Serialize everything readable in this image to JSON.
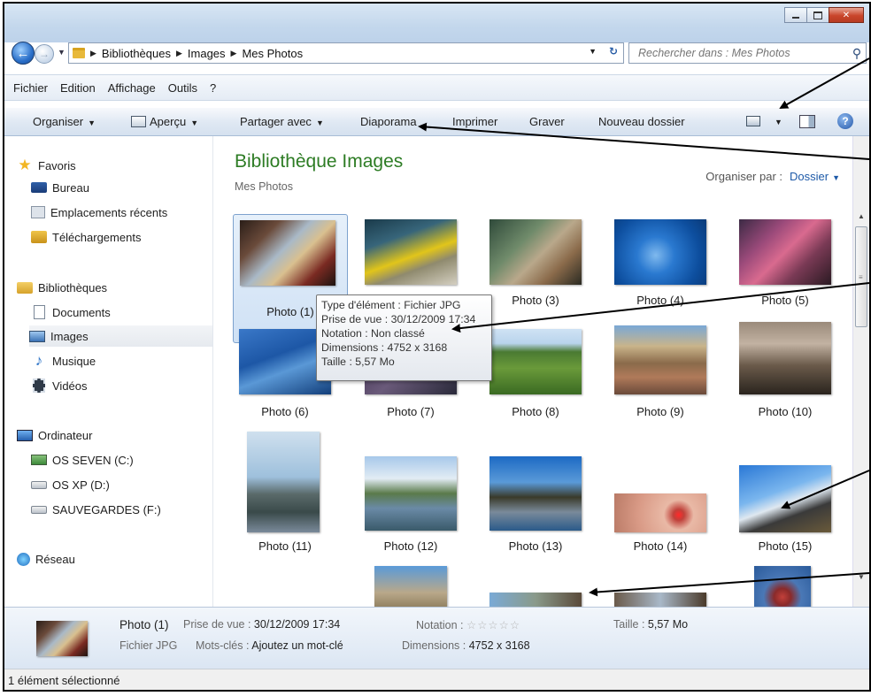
{
  "address": {
    "crumbs": [
      "Bibliothèques",
      "Images",
      "Mes Photos"
    ]
  },
  "search": {
    "placeholder": "Rechercher dans : Mes Photos"
  },
  "menu": [
    "Fichier",
    "Edition",
    "Affichage",
    "Outils",
    "?"
  ],
  "commands": {
    "organiser": "Organiser",
    "apercu": "Aperçu",
    "partager": "Partager avec",
    "diaporama": "Diaporama",
    "imprimer": "Imprimer",
    "graver": "Graver",
    "nouveau_dossier": "Nouveau dossier"
  },
  "sidebar": {
    "favoris": "Favoris",
    "bureau": "Bureau",
    "recents": "Emplacements récents",
    "telechargements": "Téléchargements",
    "bibliotheques": "Bibliothèques",
    "documents": "Documents",
    "images": "Images",
    "musique": "Musique",
    "videos": "Vidéos",
    "ordinateur": "Ordinateur",
    "drive_c": "OS SEVEN (C:)",
    "drive_d": "OS XP (D:)",
    "drive_f": "SAUVEGARDES (F:)",
    "reseau": "Réseau"
  },
  "content": {
    "title": "Bibliothèque Images",
    "subtitle": "Mes Photos",
    "arrange_label": "Organiser par :",
    "arrange_value": "Dossier"
  },
  "photos": [
    "Photo (1)",
    "Photo (3)",
    "Photo (4)",
    "Photo (5)",
    "Photo (6)",
    "Photo (7)",
    "Photo (8)",
    "Photo (9)",
    "Photo (10)",
    "Photo (11)",
    "Photo (12)",
    "Photo (13)",
    "Photo (14)",
    "Photo (15)"
  ],
  "tooltip": {
    "type": "Type d'élément : Fichier JPG",
    "taken": "Prise de vue : 30/12/2009 17:34",
    "rating": "Notation : Non classé",
    "dimensions": "Dimensions : 4752 x 3168",
    "size": "Taille : 5,57 Mo"
  },
  "details": {
    "name": "Photo (1)",
    "taken_label": "Prise de vue :",
    "taken_value": "30/12/2009 17:34",
    "rating_label": "Notation :",
    "size_label": "Taille :",
    "size_value": "5,57 Mo",
    "type": "Fichier JPG",
    "keywords_label": "Mots-clés :",
    "keywords_value": "Ajoutez un mot-clé",
    "dimensions_label": "Dimensions :",
    "dimensions_value": "4752 x 3168"
  },
  "status": "1 élément sélectionné"
}
